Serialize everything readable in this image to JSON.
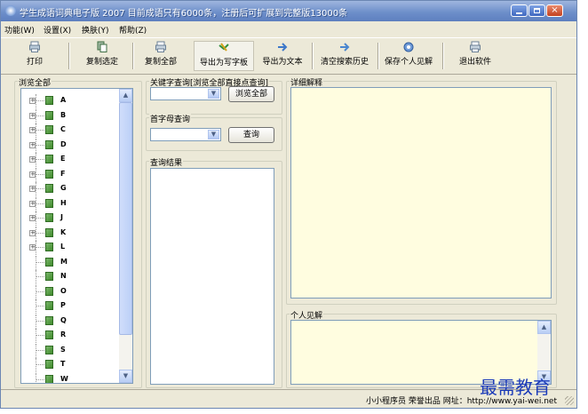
{
  "window": {
    "title": "学生成语词典电子版 2007 目前成语只有6000条，注册后可扩展到完整版13000条",
    "min_glyph": "",
    "max_glyph": "",
    "close_glyph": "×"
  },
  "menu": [
    "功能(W)",
    "设置(X)",
    "换肤(Y)",
    "帮助(Z)"
  ],
  "toolbar": [
    {
      "label": "打印",
      "icon": "print-icon"
    },
    {
      "label": "复制选定",
      "icon": "copy-selected-icon"
    },
    {
      "label": "复制全部",
      "icon": "copy-all-icon"
    },
    {
      "label": "导出为写字板",
      "icon": "export-wordpad-icon"
    },
    {
      "label": "导出为文本",
      "icon": "export-text-icon"
    },
    {
      "label": "清空搜索历史",
      "icon": "clear-history-icon"
    },
    {
      "label": "保存个人见解",
      "icon": "save-notes-icon"
    },
    {
      "label": "退出软件",
      "icon": "exit-icon"
    }
  ],
  "browse": {
    "label": "浏览全部",
    "tree": [
      {
        "label": "A",
        "expandable": true
      },
      {
        "label": "B",
        "expandable": true
      },
      {
        "label": "C",
        "expandable": true
      },
      {
        "label": "D",
        "expandable": true
      },
      {
        "label": "E",
        "expandable": true
      },
      {
        "label": "F",
        "expandable": true
      },
      {
        "label": "G",
        "expandable": true
      },
      {
        "label": "H",
        "expandable": true
      },
      {
        "label": "J",
        "expandable": true
      },
      {
        "label": "K",
        "expandable": true
      },
      {
        "label": "L",
        "expandable": true
      },
      {
        "label": "M",
        "expandable": false
      },
      {
        "label": "N",
        "expandable": false
      },
      {
        "label": "O",
        "expandable": false
      },
      {
        "label": "P",
        "expandable": false
      },
      {
        "label": "Q",
        "expandable": false
      },
      {
        "label": "R",
        "expandable": false
      },
      {
        "label": "S",
        "expandable": false
      },
      {
        "label": "T",
        "expandable": false
      },
      {
        "label": "W",
        "expandable": false
      }
    ]
  },
  "keyword": {
    "label": "关键字查询[浏览全部直接点查询]",
    "value": "",
    "button": "浏览全部"
  },
  "initial": {
    "label": "首字母查询",
    "value": "",
    "button": "查询"
  },
  "results": {
    "label": "查询结果"
  },
  "detail": {
    "label": "详细解释"
  },
  "notes": {
    "label": "个人见解"
  },
  "status": {
    "text": "小小程序员 荣誉出品 网址：http://www.yai-wei.net"
  },
  "watermark": "最需教育",
  "colors": {
    "pane_bg": "#fffde0",
    "window_bg": "#ece9d8",
    "title_blue": "#6e8fca"
  }
}
